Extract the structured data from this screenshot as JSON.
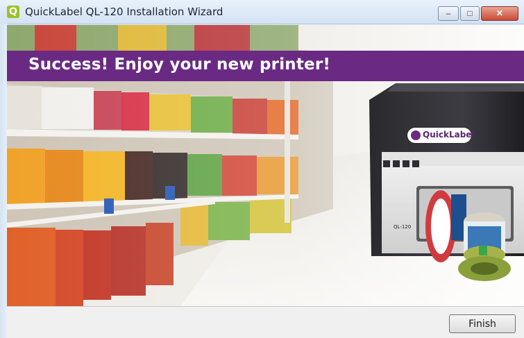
{
  "window": {
    "title": "QuickLabel QL-120 Installation Wizard",
    "app_icon_glyph": "Q",
    "controls": {
      "minimize_glyph": "–",
      "maximize_glyph": "□",
      "close_glyph": "✕"
    }
  },
  "banner": {
    "text": "Success! Enjoy your new printer!",
    "color": "#6a2a84"
  },
  "printer": {
    "brand": "QuickLabel",
    "model": "QL-120"
  },
  "footer": {
    "finish_label": "Finish"
  },
  "icons": [
    "quicklabel-app-icon",
    "minimize-icon",
    "maximize-icon",
    "close-icon",
    "quicklabel-logo-icon"
  ]
}
